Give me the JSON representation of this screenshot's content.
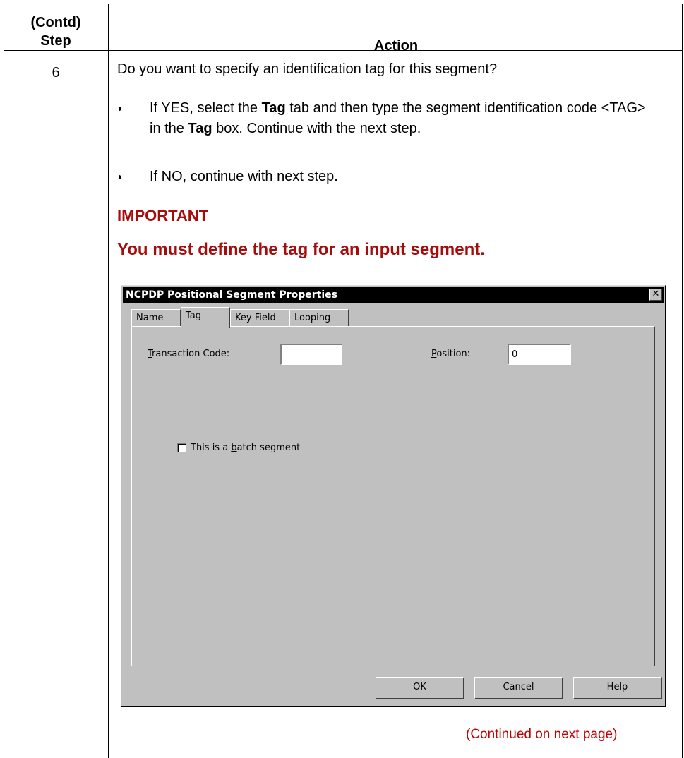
{
  "table": {
    "header_step_line1": "(Contd)",
    "header_step_line2": "Step",
    "header_action": "Action",
    "step_number": "6"
  },
  "content": {
    "question": "Do you want to specify an identification tag for this segment?",
    "bullet_marker": "◗",
    "bullet1_part1": "If YES, select the ",
    "bullet1_bold1": "Tag",
    "bullet1_part2": " tab and then type the segment identification code <TAG> in the ",
    "bullet1_bold2": "Tag",
    "bullet1_part3": " box. Continue with the next step.",
    "bullet2": "If NO, continue with next step.",
    "important_heading": "IMPORTANT",
    "important_text": "You must define the tag for an input segment.",
    "continued": "(Continued on next page)"
  },
  "dialog": {
    "title": "NCPDP Positional Segment Properties",
    "close_glyph": "✕",
    "tabs": [
      {
        "label": "Name"
      },
      {
        "label": "Tag"
      },
      {
        "label": "Key Field"
      },
      {
        "label": "Looping"
      }
    ],
    "active_tab": "Tag",
    "transaction_code_label_first": "T",
    "transaction_code_label_rest": "ransaction Code:",
    "transaction_code_value": "",
    "position_label_first": "P",
    "position_label_rest": "osition:",
    "position_value": "0",
    "batch_label_pre": "This is a ",
    "batch_label_u": "b",
    "batch_label_post": "atch segment",
    "batch_checked": false,
    "buttons": {
      "ok": "OK",
      "cancel": "Cancel",
      "help": "Help"
    }
  }
}
